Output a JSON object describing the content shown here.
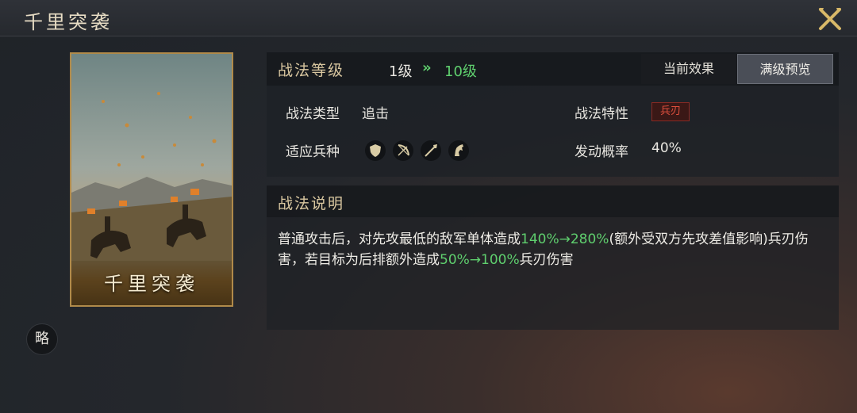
{
  "window": {
    "title": "千里突袭"
  },
  "card": {
    "name": "千里突袭"
  },
  "badge": {
    "label": "略"
  },
  "header": {
    "label": "战法等级",
    "level_current": "1级",
    "level_arrow": "»",
    "level_max": "10级",
    "tabs": [
      {
        "label": "当前效果",
        "selected": false
      },
      {
        "label": "满级预览",
        "selected": true
      }
    ]
  },
  "info": {
    "type_label": "战法类型",
    "type_value": "追击",
    "trait_label": "战法特性",
    "trait_value": "兵刃",
    "troop_label": "适应兵种",
    "troop_icons": [
      "shield-icon",
      "bow-icon",
      "spear-icon",
      "horse-icon"
    ],
    "chance_label": "发动概率",
    "chance_value": "40%"
  },
  "description": {
    "title": "战法说明",
    "part1": "普通攻击后，对先攻最低的敌军单体造成",
    "hl1": "140%→280%",
    "part2": "(额外受双方先攻差值影响)兵刃伤害，若目标为后排额外造成",
    "hl2": "50%→100%",
    "part3": "兵刃伤害"
  },
  "colors": {
    "highlight": "#5fcf6e",
    "title_gold": "#d9c7a0",
    "trait_red": "#e0503e"
  }
}
